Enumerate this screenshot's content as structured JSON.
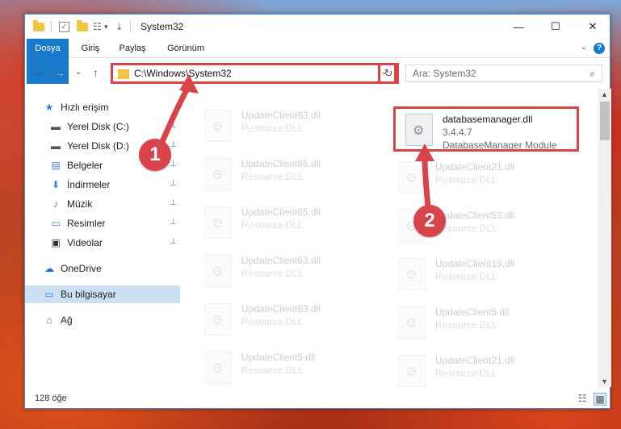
{
  "window": {
    "title": "System32",
    "controls": {
      "minimize": "—",
      "maximize": "☐",
      "close": "✕"
    },
    "qa_dropdown": "▾"
  },
  "ribbon": {
    "tabs": [
      "Dosya",
      "Giriş",
      "Paylaş",
      "Görünüm"
    ],
    "help": "?",
    "expand": "⌄"
  },
  "navigation": {
    "back": "←",
    "forward": "→",
    "recent": "⌄",
    "up": "↑",
    "address": "C:\\Windows\\System32",
    "address_dropdown": "⌄",
    "refresh": "↻",
    "search_placeholder": "Ara: System32",
    "search_icon": "⌕"
  },
  "sidebar": {
    "items": [
      {
        "label": "Hızlı erişim",
        "icon": "star-icon",
        "glyph": "★",
        "color": "#2b7dd8",
        "pinned": false
      },
      {
        "label": "Yerel Disk (C:)",
        "icon": "drive-icon",
        "glyph": "▬",
        "color": "#555555",
        "pinned": true
      },
      {
        "label": "Yerel Disk (D:)",
        "icon": "drive-icon",
        "glyph": "▬",
        "color": "#555555",
        "pinned": true
      },
      {
        "label": "Belgeler",
        "icon": "documents-icon",
        "glyph": "▤",
        "color": "#3f7fc7",
        "pinned": true
      },
      {
        "label": "İndirmeler",
        "icon": "download-icon",
        "glyph": "⬇",
        "color": "#2b7dd8",
        "pinned": true
      },
      {
        "label": "Müzik",
        "icon": "music-icon",
        "glyph": "♪",
        "color": "#2b7dd8",
        "pinned": true
      },
      {
        "label": "Resimler",
        "icon": "pictures-icon",
        "glyph": "▭",
        "color": "#3f7fc7",
        "pinned": true
      },
      {
        "label": "Videolar",
        "icon": "videos-icon",
        "glyph": "▣",
        "color": "#333333",
        "pinned": true
      },
      {
        "label": "OneDrive",
        "icon": "cloud-icon",
        "glyph": "☁",
        "color": "#1a6fd1",
        "pinned": false
      },
      {
        "label": "Bu bilgisayar",
        "icon": "computer-icon",
        "glyph": "▭",
        "color": "#2b7dd8",
        "pinned": false
      },
      {
        "label": "Ağ",
        "icon": "network-icon",
        "glyph": "⌂",
        "color": "#2b7dd8",
        "pinned": false
      }
    ],
    "pin_glyph": "📌"
  },
  "files": {
    "left": [
      {
        "name": "UpdateClient63.dll",
        "desc": "Resource DLL"
      },
      {
        "name": "UpdateClient65.dll",
        "desc": "Resource DLL"
      },
      {
        "name": "UpdateClient65.dll",
        "desc": "Resource DLL"
      },
      {
        "name": "UpdateClient63.dll",
        "desc": "Resource DLL"
      },
      {
        "name": "UpdateClient63.dll",
        "desc": "Resource DLL"
      },
      {
        "name": "UpdateClient5.dll",
        "desc": "Resource DLL"
      }
    ],
    "highlighted": {
      "name": "databasemanager.dll",
      "version": "3.4.4.7",
      "desc": "DatabaseManager Module"
    },
    "right": [
      {
        "name": "UpdateClient21.dll",
        "desc": "Resource DLL"
      },
      {
        "name": "UpdateClient53.dll",
        "desc": "Resource DLL"
      },
      {
        "name": "UpdateClient19.dll",
        "desc": "Resource DLL"
      },
      {
        "name": "UpdateClient5.dll",
        "desc": "Resource DLL"
      },
      {
        "name": "UpdateClient21.dll",
        "desc": "Resource DLL"
      }
    ]
  },
  "status": {
    "count": "128 öğe",
    "details_view": "☷",
    "tiles_view": "▦"
  },
  "callouts": [
    "1",
    "2"
  ],
  "colors": {
    "accent": "#1979ca",
    "highlight_border": "#d9434a",
    "selected_nav": "#cce0f3"
  }
}
